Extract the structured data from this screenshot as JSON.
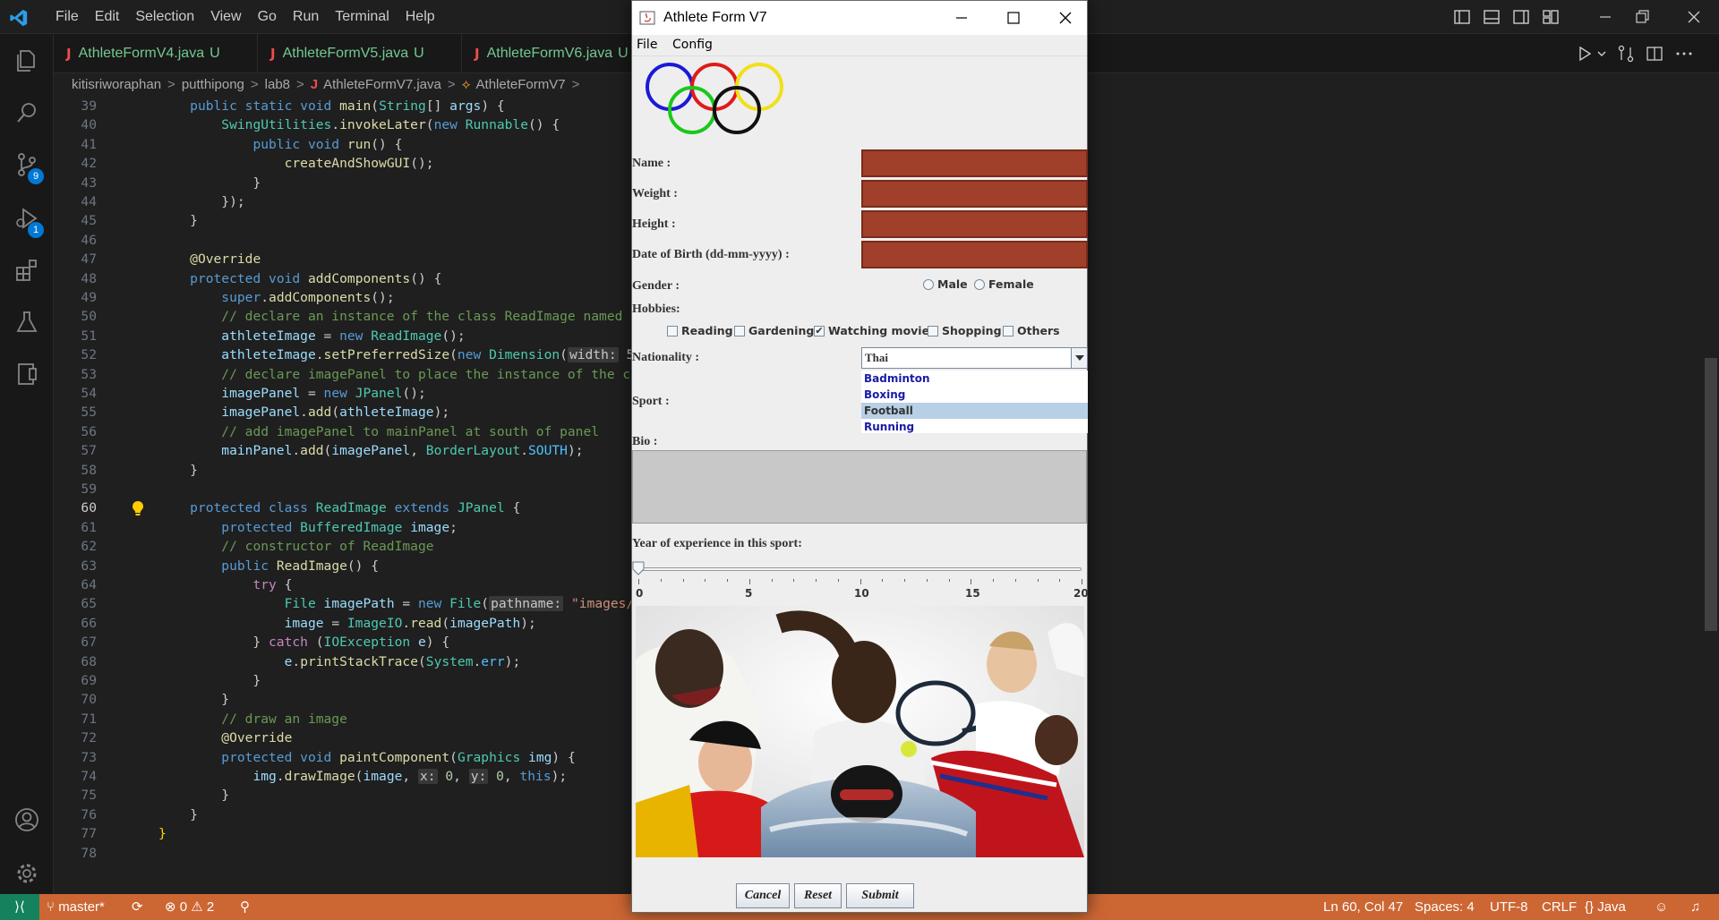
{
  "vscode": {
    "menu": [
      "File",
      "Edit",
      "Selection",
      "View",
      "Go",
      "Run",
      "Terminal",
      "Help"
    ],
    "tabs": [
      {
        "label": "AthleteFormV4.java",
        "status": "U"
      },
      {
        "label": "AthleteFormV5.java",
        "status": "U"
      },
      {
        "label": "AthleteFormV6.java",
        "status": "U"
      }
    ],
    "breadcrumb": [
      "kitisriworaphan",
      "putthipong",
      "lab8",
      "AthleteFormV7.java",
      "AthleteFormV7"
    ],
    "badges": {
      "source_control": "9",
      "run_debug": "1"
    },
    "line_numbers": [
      "39",
      "40",
      "41",
      "42",
      "43",
      "44",
      "45",
      "46",
      "47",
      "48",
      "49",
      "50",
      "51",
      "52",
      "53",
      "54",
      "55",
      "56",
      "57",
      "58",
      "59",
      "60",
      "61",
      "62",
      "63",
      "64",
      "65",
      "66",
      "67",
      "68",
      "69",
      "70",
      "71",
      "72",
      "73",
      "74",
      "75",
      "76",
      "77",
      "78"
    ],
    "current_line": "60",
    "status": {
      "branch": "master*",
      "errors": "0",
      "warnings": "2",
      "position": "Ln 60, Col 47",
      "spaces": "Spaces: 4",
      "encoding": "UTF-8",
      "eol": "CRLF",
      "language": "Java"
    },
    "icons": [
      "explorer-icon",
      "search-icon",
      "source-control-icon",
      "run-debug-icon",
      "extensions-icon",
      "testing-icon",
      "remote-explorer-icon",
      "account-icon",
      "settings-gear-icon",
      "run-icon",
      "compare-icon",
      "split-editor-icon",
      "more-actions-icon"
    ]
  },
  "java_window": {
    "title": "Athlete Form V7",
    "menu": [
      "File",
      "Config"
    ],
    "labels": {
      "name": "Name :",
      "weight": "Weight :",
      "height": "Height :",
      "dob": "Date of Birth (dd-mm-yyyy) :",
      "gender": "Gender :",
      "hobbies": "Hobbies:",
      "nationality": "Nationality :",
      "sport": "Sport :",
      "bio": "Bio :",
      "experience": "Year of experience in this sport:"
    },
    "gender_options": [
      {
        "label": "Male",
        "selected": false
      },
      {
        "label": "Female",
        "selected": false
      }
    ],
    "hobbies": [
      {
        "label": "Reading",
        "checked": false
      },
      {
        "label": "Gardening",
        "checked": false
      },
      {
        "label": "Watching movies",
        "checked": true
      },
      {
        "label": "Shopping",
        "checked": false
      },
      {
        "label": "Others",
        "checked": false
      }
    ],
    "nationality_value": "Thai",
    "sports": [
      {
        "label": "Badminton",
        "selected": false
      },
      {
        "label": "Boxing",
        "selected": false
      },
      {
        "label": "Football",
        "selected": true
      },
      {
        "label": "Running",
        "selected": false
      }
    ],
    "slider": {
      "min": 0,
      "max": 20,
      "value": 0,
      "labels": [
        "0",
        "5",
        "10",
        "15",
        "20"
      ]
    },
    "buttons": {
      "cancel": "Cancel",
      "reset": "Reset",
      "submit": "Submit"
    },
    "ring_colors": [
      "#1a1ad6",
      "#e01a1a",
      "#f0e01a",
      "#1ac81a",
      "#111111"
    ]
  }
}
